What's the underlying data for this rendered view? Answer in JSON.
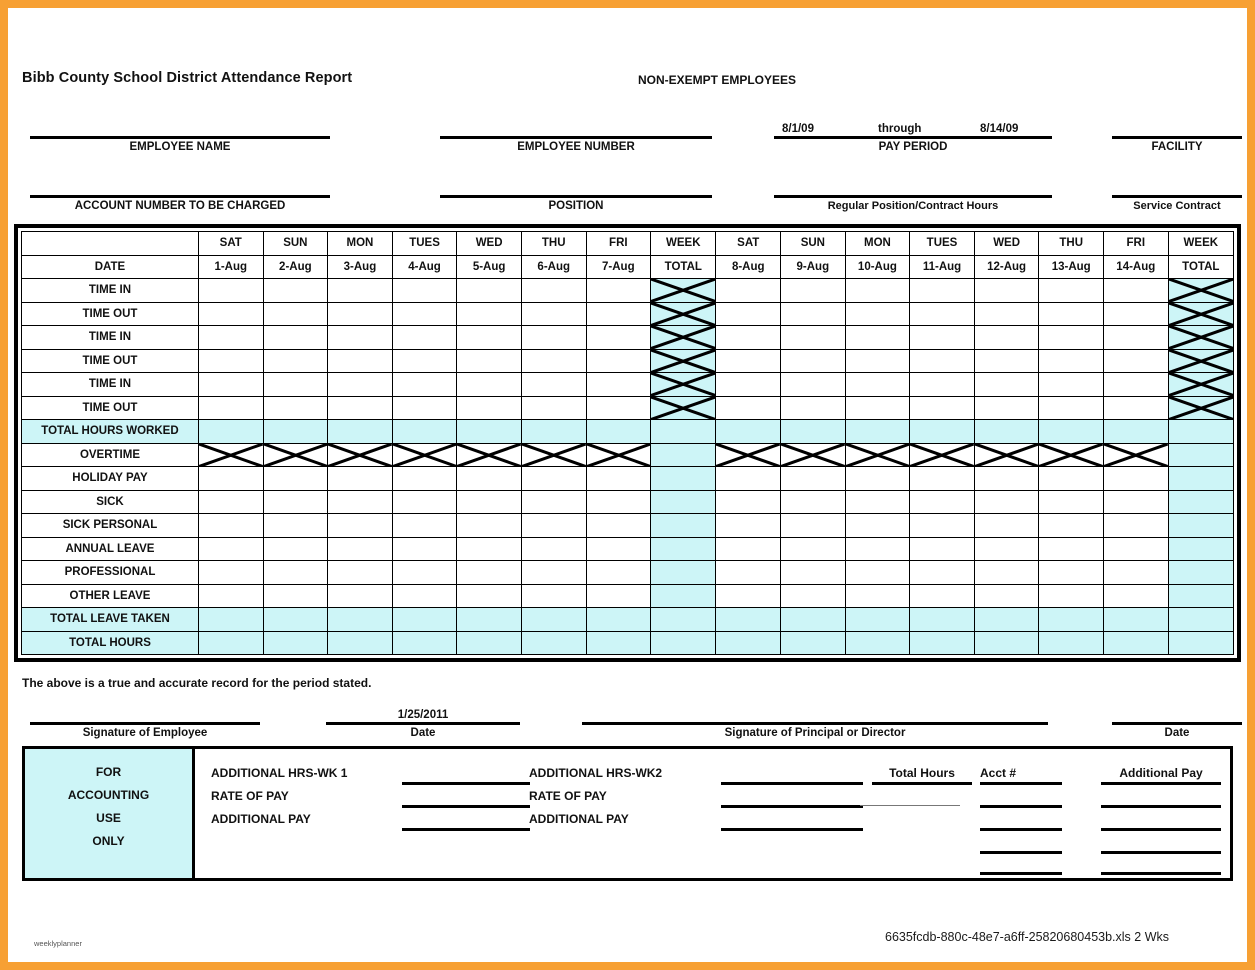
{
  "header": {
    "title": "Bibb County School District Attendance Report",
    "employee_type": "NON-EXEMPT EMPLOYEES",
    "fields": [
      {
        "caption": "EMPLOYEE NAME",
        "value": ""
      },
      {
        "caption": "EMPLOYEE NUMBER",
        "value": ""
      },
      {
        "caption": "PAY PERIOD",
        "value": ""
      },
      {
        "caption": "FACILITY",
        "value": ""
      },
      {
        "caption": "ACCOUNT NUMBER TO BE CHARGED",
        "value": ""
      },
      {
        "caption": "POSITION",
        "value": ""
      },
      {
        "caption": "Regular Position/Contract Hours",
        "value": ""
      },
      {
        "caption": "Service Contract",
        "value": ""
      }
    ],
    "pay_period": {
      "start": "8/1/09",
      "through_label": "through",
      "end": "8/14/09"
    }
  },
  "table": {
    "row_label_header": "DATE",
    "week_total_label_line1": "WEEK",
    "week_total_label_line2": "TOTAL",
    "days": [
      {
        "dow": "SAT",
        "date": "1-Aug",
        "bold_date": true
      },
      {
        "dow": "SUN",
        "date": "2-Aug",
        "bold_date": false
      },
      {
        "dow": "MON",
        "date": "3-Aug",
        "bold_date": false
      },
      {
        "dow": "TUES",
        "date": "4-Aug",
        "bold_date": false
      },
      {
        "dow": "WED",
        "date": "5-Aug",
        "bold_date": false
      },
      {
        "dow": "THU",
        "date": "6-Aug",
        "bold_date": false
      },
      {
        "dow": "FRI",
        "date": "7-Aug",
        "bold_date": false
      },
      {
        "dow": "SAT",
        "date": "8-Aug",
        "bold_date": false
      },
      {
        "dow": "SUN",
        "date": "9-Aug",
        "bold_date": false
      },
      {
        "dow": "MON",
        "date": "10-Aug",
        "bold_date": false
      },
      {
        "dow": "TUES",
        "date": "11-Aug",
        "bold_date": false
      },
      {
        "dow": "WED",
        "date": "12-Aug",
        "bold_date": false
      },
      {
        "dow": "THU",
        "date": "13-Aug",
        "bold_date": false
      },
      {
        "dow": "FRI",
        "date": "14-Aug",
        "bold_date": false
      }
    ],
    "rows": [
      {
        "label": "TIME IN",
        "highlight": false,
        "day_x": false,
        "total_x": true
      },
      {
        "label": "TIME OUT",
        "highlight": false,
        "day_x": false,
        "total_x": true
      },
      {
        "label": "TIME IN",
        "highlight": false,
        "day_x": false,
        "total_x": true
      },
      {
        "label": "TIME OUT",
        "highlight": false,
        "day_x": false,
        "total_x": true
      },
      {
        "label": "TIME IN",
        "highlight": false,
        "day_x": false,
        "total_x": true
      },
      {
        "label": "TIME OUT",
        "highlight": false,
        "day_x": false,
        "total_x": true
      },
      {
        "label": "TOTAL HOURS WORKED",
        "highlight": true,
        "day_x": false,
        "total_x": false
      },
      {
        "label": "OVERTIME",
        "highlight": false,
        "day_x": true,
        "total_x": false
      },
      {
        "label": "HOLIDAY PAY",
        "highlight": false,
        "day_x": false,
        "total_x": false
      },
      {
        "label": "SICK",
        "highlight": false,
        "day_x": false,
        "total_x": false
      },
      {
        "label": "SICK PERSONAL",
        "highlight": false,
        "day_x": false,
        "total_x": false
      },
      {
        "label": "ANNUAL LEAVE",
        "highlight": false,
        "day_x": false,
        "total_x": false
      },
      {
        "label": "PROFESSIONAL",
        "highlight": false,
        "day_x": false,
        "total_x": false
      },
      {
        "label": "OTHER LEAVE",
        "highlight": false,
        "day_x": false,
        "total_x": false
      },
      {
        "label": "TOTAL LEAVE TAKEN",
        "highlight": true,
        "day_x": false,
        "total_x": false
      },
      {
        "label": "TOTAL HOURS",
        "highlight": true,
        "day_x": false,
        "total_x": false
      }
    ]
  },
  "attestation": "The above is a true and accurate record for the period stated.",
  "signatures": [
    {
      "caption": "Signature of Employee",
      "value": ""
    },
    {
      "caption": "Date",
      "value": "1/25/2011"
    },
    {
      "caption": "Signature of Principal or Director",
      "value": ""
    },
    {
      "caption": "Date",
      "value": ""
    }
  ],
  "accounting": {
    "side_label_lines": [
      "FOR",
      "ACCOUNTING",
      "USE",
      "ONLY"
    ],
    "week1": [
      "ADDITIONAL HRS-WK 1",
      "RATE OF PAY",
      "ADDITIONAL PAY"
    ],
    "week2": [
      "ADDITIONAL HRS-WK2",
      "RATE OF PAY",
      "ADDITIONAL PAY"
    ],
    "column_headers": {
      "total_hours": "Total Hours",
      "acct_number": "Acct #",
      "additional_pay": "Additional Pay"
    }
  },
  "footer": {
    "watermark": "weeklyplanner",
    "filename": "6635fcdb-880c-48e7-a6ff-25820680453b.xls 2 Wks"
  },
  "colors": {
    "page_border": "#f7a033",
    "highlight": "#cdf5f7",
    "rule": "#000000"
  }
}
